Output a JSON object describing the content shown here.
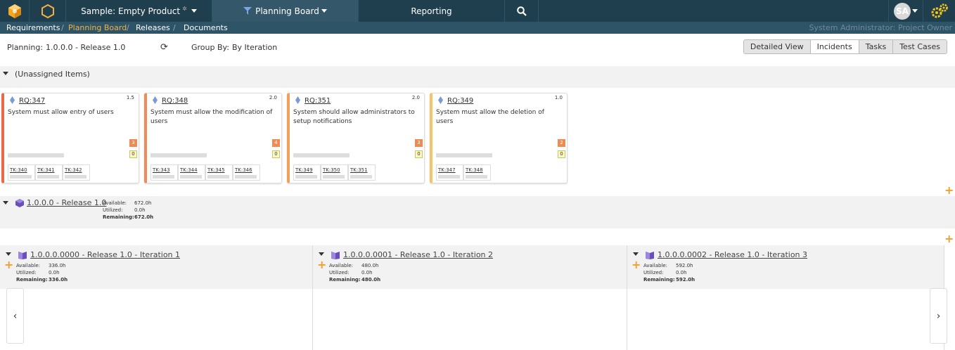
{
  "topbar": {
    "product": "Sample: Empty Product",
    "planning_board": "Planning Board",
    "reporting": "Reporting",
    "avatar_initials": "SA"
  },
  "subnav": {
    "requirements": "Requirements",
    "planning_board": "Planning Board",
    "releases": "Releases",
    "documents": "Documents",
    "user_role": "System Administrator: Project Owner",
    "sep": "/"
  },
  "toolbar": {
    "planning_label": "Planning:",
    "planning_value": "1.0.0.0 - Release 1.0",
    "group_by_label": "Group By:",
    "group_by_value": "By Iteration",
    "views": [
      "Detailed View",
      "Incidents",
      "Tasks",
      "Test Cases"
    ]
  },
  "unassigned": {
    "title": "(Unassigned Items)",
    "cards": [
      {
        "id": "RQ:347",
        "points": "1.5",
        "desc": "System must allow entry of users",
        "badge1": "3",
        "badge2": "0",
        "border": "#e8684a",
        "tasks": [
          "TK:340",
          "TK:341",
          "TK:342"
        ]
      },
      {
        "id": "RQ:348",
        "points": "2.0",
        "desc": "System must allow the modification of users",
        "badge1": "4",
        "badge2": "0",
        "border": "#ef8a5a",
        "tasks": [
          "TK:343",
          "TK:344",
          "TK:345",
          "TK:346"
        ]
      },
      {
        "id": "RQ:351",
        "points": "2.0",
        "desc": "System should allow administrators to setup notifications",
        "badge1": "3",
        "badge2": "0",
        "border": "#efa05a",
        "tasks": [
          "TK:349",
          "TK:350",
          "TK:351"
        ]
      },
      {
        "id": "RQ:349",
        "points": "1.0",
        "desc": "System must allow the deletion of users",
        "badge1": "2",
        "badge2": "0",
        "border": "#f3c468",
        "tasks": [
          "TK:347",
          "TK:348"
        ]
      }
    ]
  },
  "release": {
    "title": "1.0.0.0 - Release 1.0",
    "available_label": "Available:",
    "available": "672.0h",
    "utilized_label": "Utilized:",
    "utilized": "0.0h",
    "remaining_label": "Remaining:",
    "remaining": "672.0h"
  },
  "iterations": [
    {
      "title": "1.0.0.0.0000 - Release 1.0 - Iteration 1",
      "available": "336.0h",
      "utilized": "0.0h",
      "remaining": "336.0h"
    },
    {
      "title": "1.0.0.0.0001 - Release 1.0 - Iteration 2",
      "available": "480.0h",
      "utilized": "0.0h",
      "remaining": "480.0h"
    },
    {
      "title": "1.0.0.0.0002 - Release 1.0 - Iteration 3",
      "available": "592.0h",
      "utilized": "0.0h",
      "remaining": "592.0h"
    }
  ],
  "icons": {
    "logo": "cube-logo-icon",
    "hex": "hexagon-icon",
    "search": "search-icon",
    "gears": "gears-icon",
    "refresh": "refresh-icon",
    "prev": "chevron-left-icon",
    "next": "chevron-right-icon"
  },
  "colors": {
    "topbar": "#1f3f4f",
    "accent": "#f5b041",
    "plus": "#f0a030"
  }
}
